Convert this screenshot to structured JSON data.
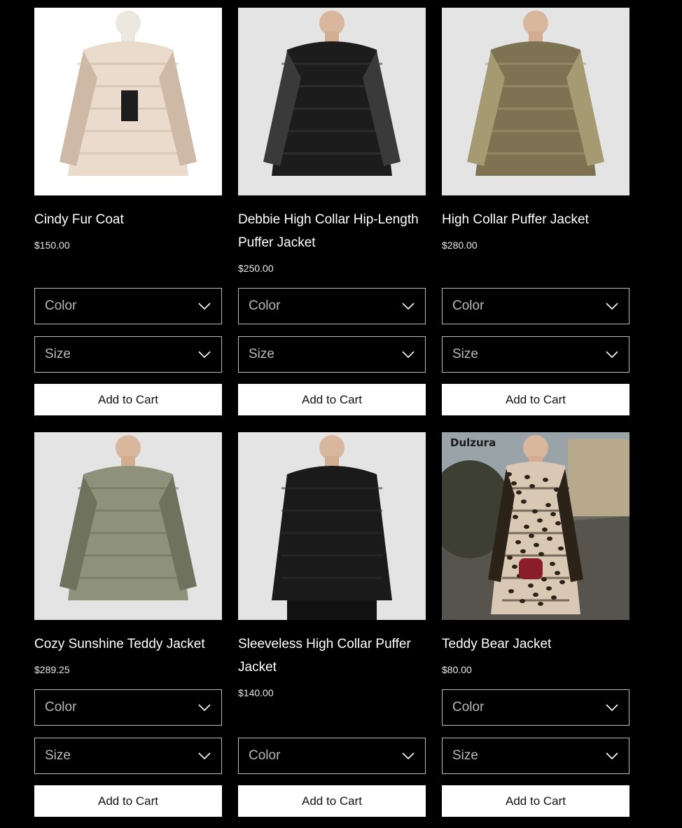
{
  "products": [
    {
      "name": "Cindy Fur Coat",
      "price": "$150.00",
      "options": [
        "Color",
        "Size"
      ],
      "cta": "Add to Cart",
      "image_label": "",
      "colors": {
        "bg": "#ffffff",
        "garment": "#eadbcc",
        "shade": "#cdb9a6"
      }
    },
    {
      "name": "Debbie High Collar Hip-Length Puffer Jacket",
      "price": "$250.00",
      "options": [
        "Color",
        "Size"
      ],
      "cta": "Add to Cart",
      "image_label": "",
      "colors": {
        "bg": "#e4e4e4",
        "garment": "#1c1c1c",
        "shade": "#3a3a3a"
      }
    },
    {
      "name": "High Collar Puffer Jacket",
      "price": "$280.00",
      "options": [
        "Color",
        "Size"
      ],
      "cta": "Add to Cart",
      "image_label": "",
      "colors": {
        "bg": "#e4e4e4",
        "garment": "#7d7353",
        "shade": "#a59a72"
      }
    },
    {
      "name": "Cozy Sunshine Teddy Jacket",
      "price": "$289.25",
      "options": [
        "Color",
        "Size"
      ],
      "cta": "Add to Cart",
      "image_label": "",
      "colors": {
        "bg": "#e4e4e4",
        "garment": "#8e927a",
        "shade": "#6f735d"
      }
    },
    {
      "name": "Sleeveless High Collar Puffer Jacket",
      "price": "$140.00",
      "options": [
        "Color"
      ],
      "cta": "Add to Cart",
      "image_label": "",
      "colors": {
        "bg": "#e4e4e4",
        "garment": "#1a1a1a",
        "shade": "#2f2f2f"
      }
    },
    {
      "name": "Teddy Bear Jacket",
      "price": "$80.00",
      "options": [
        "Color",
        "Size"
      ],
      "cta": "Add to Cart",
      "image_label": "Dulzura",
      "colors": {
        "bg": "#6d6a62",
        "garment": "#d9c8b3",
        "shade": "#2b2218"
      }
    }
  ]
}
